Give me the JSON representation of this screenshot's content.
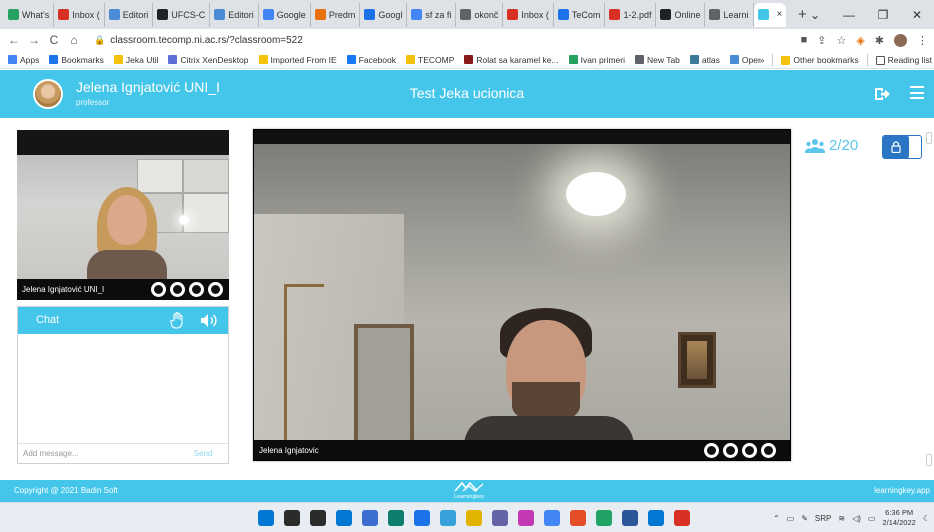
{
  "browser": {
    "tabs": [
      {
        "label": "What's",
        "color": "#25a162"
      },
      {
        "label": "Inbox (",
        "color": "#d93025"
      },
      {
        "label": "Editori",
        "color": "#4a8bd6"
      },
      {
        "label": "UFCS-C",
        "color": "#202124"
      },
      {
        "label": "Editori",
        "color": "#4a8bd6"
      },
      {
        "label": "Google",
        "color": "#4285f4"
      },
      {
        "label": "Predm",
        "color": "#e8710a"
      },
      {
        "label": "Googl",
        "color": "#1a73e8"
      },
      {
        "label": "sf za fi",
        "color": "#4285f4"
      },
      {
        "label": "okonč",
        "color": "#5f6368"
      },
      {
        "label": "Inbox (",
        "color": "#d93025"
      },
      {
        "label": "TeCom",
        "color": "#1a73e8"
      },
      {
        "label": "1-2.pdf",
        "color": "#d93025"
      },
      {
        "label": "Online",
        "color": "#202124"
      },
      {
        "label": "Learni",
        "color": "#5f6368"
      },
      {
        "label": "",
        "color": "#44c6ea"
      }
    ],
    "new_tab": "+",
    "window_controls": {
      "minimize": "—",
      "restore": "❐",
      "close": "✕",
      "dropdown": "⌄"
    },
    "nav": {
      "back": "←",
      "forward": "→",
      "reload": "C",
      "home": "⌂"
    },
    "url": "classroom.tecomp.ni.ac.rs/?classroom=522",
    "bookmarks": [
      {
        "label": "Apps",
        "color": "#4285f4"
      },
      {
        "label": "Bookmarks",
        "color": "#1a73e8"
      },
      {
        "label": "Jeka Util",
        "color": "#f4c20d"
      },
      {
        "label": "Citrix XenDesktop",
        "color": "#5b6fd6"
      },
      {
        "label": "Imported From IE",
        "color": "#f4c20d"
      },
      {
        "label": "Facebook",
        "color": "#1877f2"
      },
      {
        "label": "TECOMP",
        "color": "#f4c20d"
      },
      {
        "label": "Rolat sa karamel ke...",
        "color": "#8b1a1a"
      },
      {
        "label": "Ivan primeri",
        "color": "#25a162"
      },
      {
        "label": "New Tab",
        "color": "#5f6368"
      },
      {
        "label": "atlas",
        "color": "#3c7a9b"
      },
      {
        "label": "Open Lectures | Si...",
        "color": "#4a8bd6"
      }
    ],
    "bookmarks_more": "»",
    "other_bookmarks": "Other bookmarks",
    "reading_list": "Reading list"
  },
  "app": {
    "professor_name": "Jelena Ignjatović UNI_I",
    "professor_role": "professor",
    "classroom_title": "Test Jeka ucionica",
    "accent": "#44c6ea",
    "participants": "2/20"
  },
  "small_video": {
    "name": "Jelena Ignjatović UNI_I"
  },
  "main_video": {
    "name": "Jelena Ignjatovic"
  },
  "chat": {
    "title": "Chat",
    "placeholder": "Add message...",
    "send_label": "Send"
  },
  "footer": {
    "copyright": "Copyright @ 2021 Badin Soft",
    "brand": "Learningkey",
    "site": "learningkey.app"
  },
  "taskbar": {
    "lang": "SRP",
    "time": "6:36 PM",
    "date": "2/14/2022",
    "icons": [
      "#0078d4",
      "#2b2b2b",
      "#2b2b2b",
      "#0078d4",
      "#3b6ecf",
      "#0d7d6d",
      "#1a73e8",
      "#38a1db",
      "#e0b400",
      "#6264a7",
      "#c239b3",
      "#4285f4",
      "#e44d26",
      "#21a366",
      "#2b579a",
      "#0078d4",
      "#d93025"
    ]
  }
}
